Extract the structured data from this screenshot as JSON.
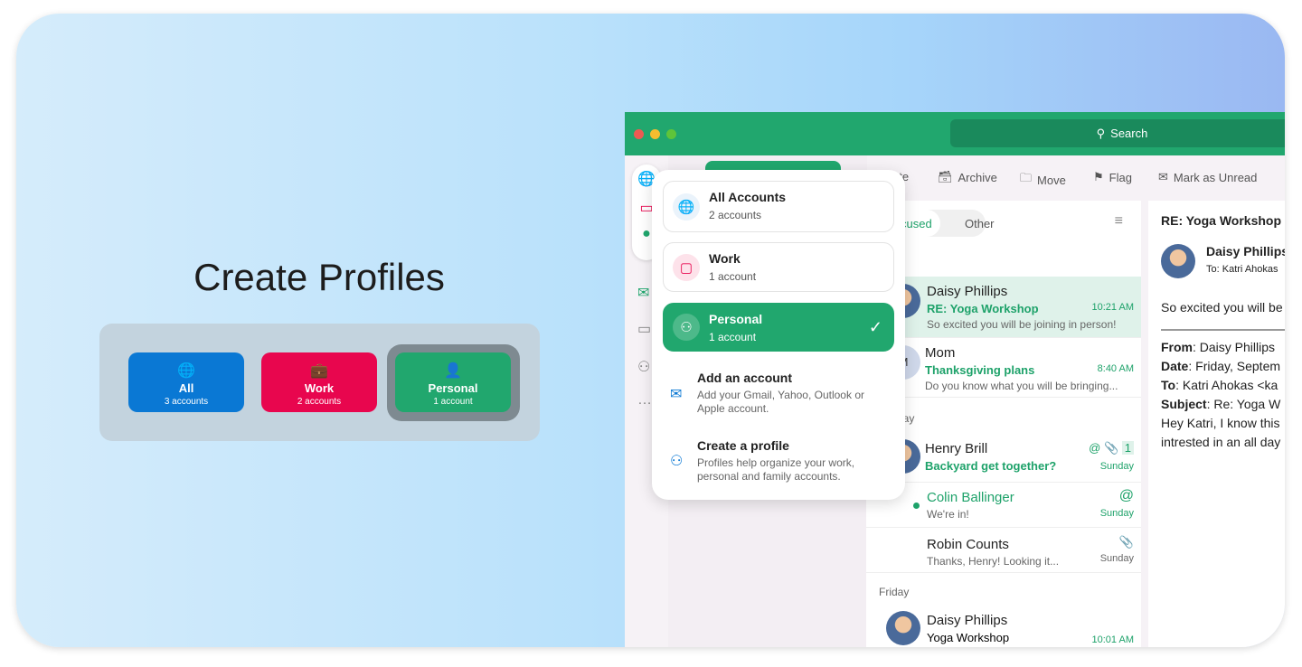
{
  "hero": {
    "title": "Create Profiles",
    "profiles": [
      {
        "name": "All",
        "count": "3 accounts",
        "color": "#0a78d4",
        "icon": "globe-icon"
      },
      {
        "name": "Work",
        "count": "2 accounts",
        "color": "#e8064e",
        "icon": "briefcase-icon"
      },
      {
        "name": "Personal",
        "count": "1 account",
        "color": "#21a76e",
        "icon": "person-icon",
        "selected": true
      }
    ]
  },
  "app": {
    "search": "Search",
    "toolbar": [
      "ete",
      "Archive",
      "Move",
      "Flag",
      "Mark as Unread"
    ],
    "tabs": {
      "focused": "cused",
      "other": "Other"
    },
    "menu": {
      "items": [
        {
          "title": "All Accounts",
          "sub": "2 accounts"
        },
        {
          "title": "Work",
          "sub": "1 account"
        },
        {
          "title": "Personal",
          "sub": "1 account",
          "selected": true
        }
      ],
      "add": {
        "title": "Add an account",
        "sub": "Add your Gmail, Yahoo, Outlook or Apple account."
      },
      "create": {
        "title": "Create a profile",
        "sub": "Profiles help organize your work, personal and family accounts."
      }
    },
    "days": {
      "d1": "y",
      "d2": "rday",
      "d3": "Friday"
    },
    "mails": [
      {
        "from": "Daisy Phillips",
        "subject": "RE: Yoga Workshop",
        "time": "10:21 AM",
        "preview": "So excited you will be joining in person!"
      },
      {
        "from": "Mom",
        "initial": "M",
        "subject": "Thanksgiving plans",
        "time": "8:40 AM",
        "preview": "Do you know what you will be bringing..."
      },
      {
        "from": "Henry Brill",
        "subject": "Backyard get together?",
        "time": "Sunday",
        "count": "1"
      },
      {
        "from": "Colin Ballinger",
        "preview": "We're in!",
        "time": "Sunday"
      },
      {
        "from": "Robin Counts",
        "preview": "Thanks, Henry! Looking it...",
        "time": "Sunday"
      },
      {
        "from": "Daisy Phillips",
        "subject": "Yoga Workshop",
        "time": "10:01 AM"
      }
    ],
    "reading": {
      "subject": "RE: Yoga Workshop",
      "from": "Daisy Phillips",
      "to_label": "To:",
      "to": "Katri Ahokas",
      "body": "So excited you will be",
      "hdr": [
        {
          "k": "From",
          "v": ": Daisy Phillips"
        },
        {
          "k": "Date",
          "v": ": Friday, Septem"
        },
        {
          "k": "To",
          "v": ": Katri Ahokas <ka"
        },
        {
          "k": "Subject",
          "v": ": Re: Yoga W"
        }
      ],
      "l1": "Hey Katri, I know this",
      "l2": "intrested in an all day"
    }
  }
}
